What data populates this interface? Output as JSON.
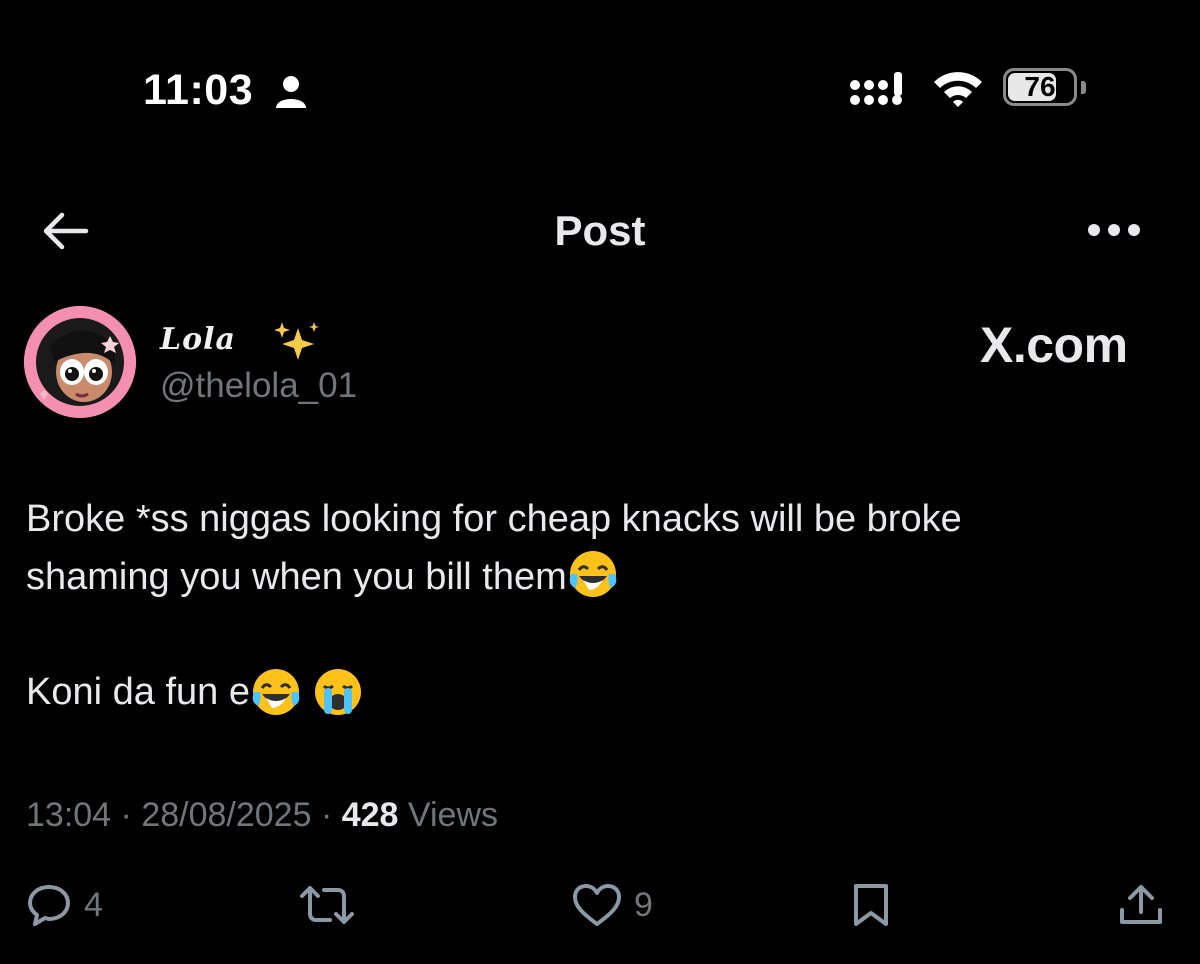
{
  "status_bar": {
    "time": "11:03",
    "battery": "76",
    "battery_level": 0.76,
    "icons": [
      "person-icon",
      "cellular-signal-icon",
      "wifi-icon",
      "battery-icon"
    ]
  },
  "nav": {
    "back_icon": "back-arrow-icon",
    "title": "Post",
    "more_icon": "more-options-icon"
  },
  "author": {
    "display_name": "Lola",
    "emoji_icon": "sparkles-icon",
    "handle": "@thelola_01",
    "avatar": "avatar"
  },
  "watermark": "X.com",
  "post": {
    "line1": "Broke *ss niggas looking for cheap knacks will be broke",
    "line2": "shaming you when you bill them",
    "line3": "Koni da fun e",
    "emojis": [
      "face-with-tears-of-joy-icon",
      "face-with-tears-of-joy-icon",
      "loudly-crying-face-icon"
    ]
  },
  "meta": {
    "time": "13:04",
    "separator": "·",
    "date": "28/08/2025",
    "views_count": "428",
    "views_label": "Views"
  },
  "actions": {
    "reply_count": "4",
    "repost_count": "",
    "like_count": "9",
    "icons": [
      "reply-icon",
      "repost-icon",
      "like-icon",
      "bookmark-icon",
      "share-icon"
    ]
  },
  "colors": {
    "background": "#000000",
    "text_primary": "#e7e9ea",
    "text_secondary": "#71767b"
  }
}
